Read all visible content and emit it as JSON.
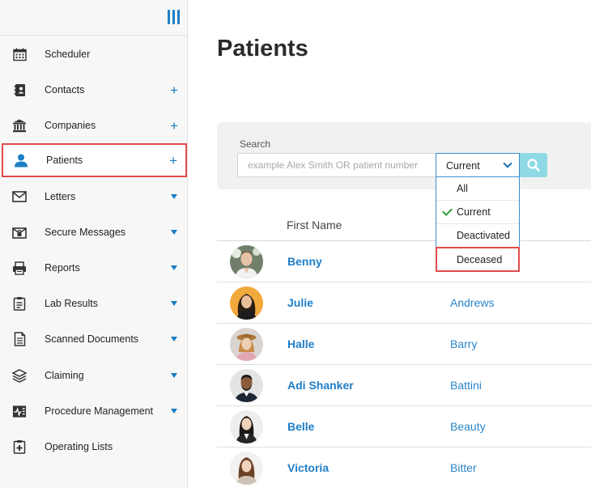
{
  "sidebar": {
    "items": [
      {
        "label": "Scheduler",
        "icon": "calendar-icon",
        "action": ""
      },
      {
        "label": "Contacts",
        "icon": "contacts-book-icon",
        "action": "+"
      },
      {
        "label": "Companies",
        "icon": "bank-building-icon",
        "action": "+"
      },
      {
        "label": "Patients",
        "icon": "person-icon",
        "action": "+"
      },
      {
        "label": "Letters",
        "icon": "envelope-icon",
        "action": "caret"
      },
      {
        "label": "Secure Messages",
        "icon": "secure-mail-icon",
        "action": "caret"
      },
      {
        "label": "Reports",
        "icon": "printer-icon",
        "action": "caret"
      },
      {
        "label": "Lab Results",
        "icon": "clipboard-icon",
        "action": "caret"
      },
      {
        "label": "Scanned Documents",
        "icon": "document-icon",
        "action": "caret"
      },
      {
        "label": "Claiming",
        "icon": "layers-icon",
        "action": "caret"
      },
      {
        "label": "Procedure Management",
        "icon": "procedure-chart-icon",
        "action": "caret"
      },
      {
        "label": "Operating Lists",
        "icon": "medical-clipboard-icon",
        "action": ""
      }
    ],
    "selected": "Patients"
  },
  "main": {
    "title": "Patients",
    "search": {
      "label": "Search",
      "placeholder": "example Alex Smith OR patient number",
      "value": ""
    },
    "status_filter": {
      "selected": "Current",
      "options": [
        "All",
        "Current",
        "Deactivated",
        "Deceased"
      ],
      "highlighted": "Deceased"
    },
    "table": {
      "columns": [
        "First Name"
      ],
      "rows": [
        {
          "first": "Benny",
          "last": ""
        },
        {
          "first": "Julie",
          "last": "Andrews"
        },
        {
          "first": "Halle",
          "last": "Barry"
        },
        {
          "first": "Adi Shanker",
          "last": "Battini"
        },
        {
          "first": "Belle",
          "last": "Beauty"
        },
        {
          "first": "Victoria",
          "last": "Bitter"
        }
      ]
    }
  },
  "colors": {
    "accent": "#1e7ec8",
    "highlight_border": "#e14b4b",
    "check": "#2a9d3c",
    "search_button": "#8fd9e6"
  }
}
